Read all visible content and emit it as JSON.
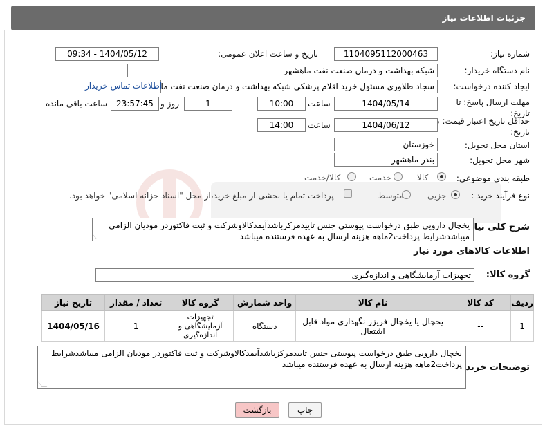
{
  "header": {
    "title": "جزئیات اطلاعات نیاز"
  },
  "fields": {
    "need_number_label": "شماره نیاز:",
    "need_number": "1104095112000463",
    "announce_label": "تاریخ و ساعت اعلان عمومی:",
    "announce_value": "1404/05/12 - 09:34",
    "buyer_org_label": "نام دستگاه خریدار:",
    "buyer_org": "شبکه بهداشت و درمان صنعت نفت ماهشهر",
    "creator_label": "ایجاد کننده درخواست:",
    "creator": "سجاد طلاوری مسئول خرید اقلام پزشکی شبکه بهداشت و درمان صنعت نفت ماهشهر",
    "contact_link": "اطلاعات تماس خریدار",
    "deadline_label": "مهلت ارسال پاسخ: تا تاریخ:",
    "deadline_date": "1404/05/14",
    "time_label": "ساعت",
    "deadline_time": "10:00",
    "days_value": "1",
    "days_label": "روز و",
    "remaining_time": "23:57:45",
    "remaining_label": "ساعت باقی مانده",
    "validity_label": "حداقل تاریخ اعتبار قیمت: تا تاریخ:",
    "validity_date": "1404/06/12",
    "validity_time": "14:00",
    "province_label": "استان محل تحویل:",
    "province": "خوزستان",
    "city_label": "شهر محل تحویل:",
    "city": "بندر ماهشهر",
    "category_label": "طبقه بندی موضوعی:",
    "category_options": [
      "کالا",
      "خدمت",
      "کالا/خدمت"
    ],
    "process_label": "نوع فرآیند خرید :",
    "process_options": [
      "جزیی",
      "متوسط"
    ],
    "process_note": "پرداخت تمام یا بخشی از مبلغ خرید،از محل \"اسناد خزانه اسلامی\" خواهد بود."
  },
  "description": {
    "label": "شرح کلی نیاز:",
    "text": "یخچال دارویی طبق درخواست پیوستی جنس تاییدمرکزباشدآیمدکالاوشرکت و ثبت فاکتوردر مودیان الزامی میباشدشرایط پرداخت2ماهه هزینه ارسال به عهده فرستنده میباشد"
  },
  "goods_section": {
    "title": "اطلاعات کالاهای مورد نیاز",
    "group_label": "گروه کالا:",
    "group_value": "تجهیزات آزمایشگاهی و اندازه‌گیری"
  },
  "table": {
    "headers": [
      "ردیف",
      "کد کالا",
      "نام کالا",
      "واحد شمارش",
      "گروه کالا",
      "تعداد / مقدار",
      "تاریخ نیاز"
    ],
    "rows": [
      [
        "1",
        "--",
        "یخچال یا یخچال فریزر نگهداری مواد قابل اشتعال",
        "دستگاه",
        "تجهیزات آزمایشگاهی و اندازه‌گیری",
        "1",
        "1404/05/16"
      ]
    ]
  },
  "buyer_notes": {
    "label": "توضیحات خریدار:",
    "text": "یخچال دارویی طبق درخواست پیوستی جنس تاییدمرکزباشدآیمدکالاوشرکت و ثبت فاکتوردر مودیان الزامی میباشدشرایط پرداخت2ماهه هزینه ارسال به عهده فرستنده میباشد"
  },
  "buttons": {
    "print": "چاپ",
    "back": "بازگشت"
  },
  "colors": {
    "header_bg": "#6b6b6b",
    "link": "#1e4f9c",
    "back_button_bg": "#f7c6c6"
  }
}
